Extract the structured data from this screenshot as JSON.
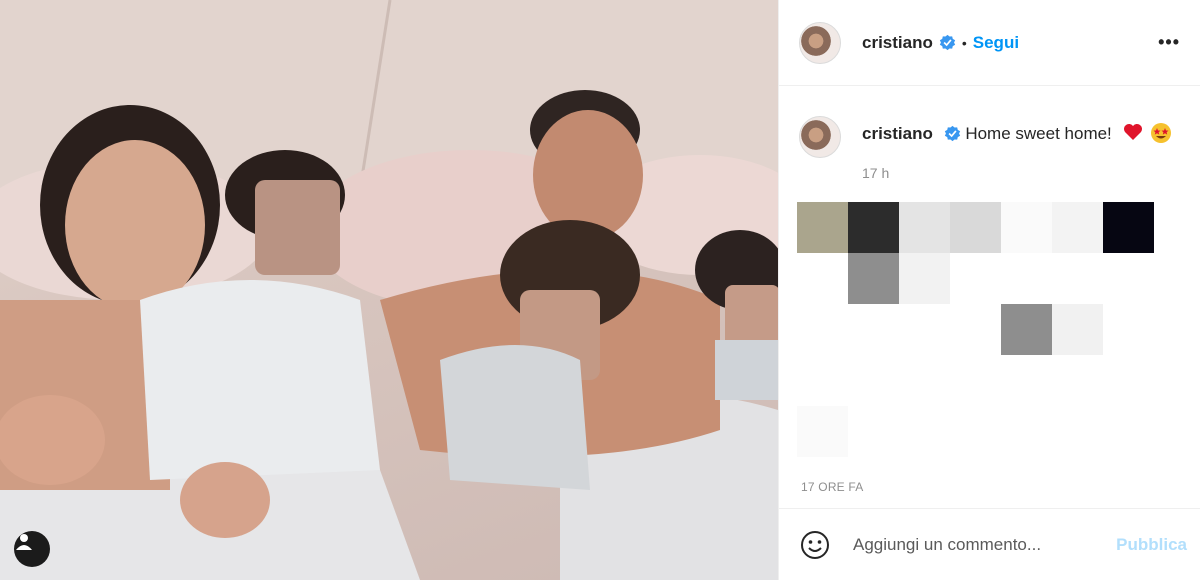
{
  "post": {
    "username": "cristiano",
    "verified": true,
    "follow_separator": "•",
    "follow_label": "Segui",
    "more_label": "•••"
  },
  "caption": {
    "username": "cristiano",
    "text": "Home sweet home!",
    "emojis": [
      "red-heart",
      "star-struck-face"
    ],
    "relative_time": "17 h"
  },
  "posted_ago": "17 ORE FA",
  "comment": {
    "placeholder": "Aggiungi un commento...",
    "publish_label": "Pubblica"
  },
  "colors": {
    "link_blue": "#0095f6",
    "publish_disabled": "#b2dffc",
    "verified_blue": "#3897f0",
    "meta_gray": "#8e8e8e"
  }
}
